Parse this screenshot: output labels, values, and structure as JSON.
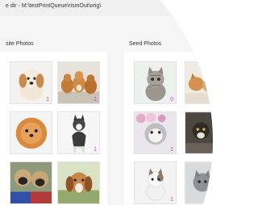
{
  "path_text": "e dir - M:\\testPrintQueue\\rismOut\\orig\\",
  "left_panel": {
    "title": "site Photos",
    "items": [
      {
        "subject": "puppy",
        "badge": "1"
      },
      {
        "subject": "puppies-group",
        "badge": "1"
      },
      {
        "subject": "pomeranian",
        "badge": ""
      },
      {
        "subject": "husky",
        "badge": "1"
      },
      {
        "subject": "pugs",
        "badge": ""
      },
      {
        "subject": "beagle",
        "badge": ""
      }
    ]
  },
  "right_panel": {
    "title": "Seed Photos",
    "items": [
      {
        "subject": "tabby-kitten",
        "badge": "0"
      },
      {
        "subject": "kittens-group",
        "badge": ""
      },
      {
        "subject": "flower-cat",
        "badge": "1"
      },
      {
        "subject": "dark-cat",
        "badge": ""
      },
      {
        "subject": "kitten-white",
        "badge": "1"
      },
      {
        "subject": "gray-cat",
        "badge": ""
      }
    ]
  },
  "colors": {
    "badge": "#d03ad0",
    "panel": "#ffffff",
    "background": "#f5f5f6"
  }
}
